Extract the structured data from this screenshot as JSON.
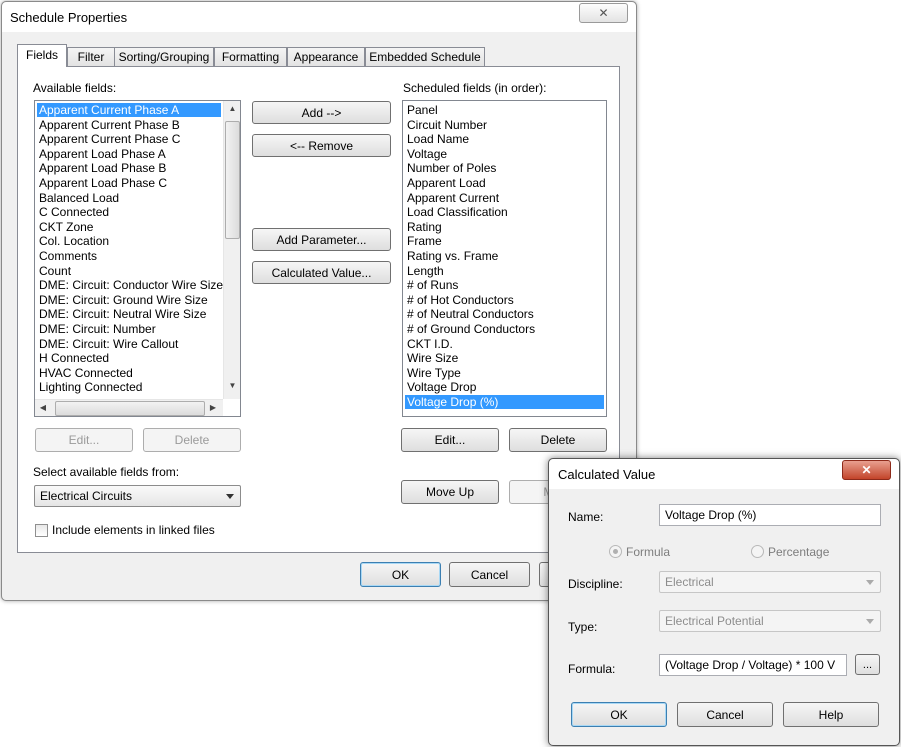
{
  "schedule_properties": {
    "title": "Schedule Properties",
    "tabs": [
      "Fields",
      "Filter",
      "Sorting/Grouping",
      "Formatting",
      "Appearance",
      "Embedded Schedule"
    ],
    "active_tab": "Fields",
    "available_fields_label": "Available fields:",
    "available_fields": [
      "Apparent Current Phase A",
      "Apparent Current Phase B",
      "Apparent Current Phase C",
      "Apparent Load Phase A",
      "Apparent Load Phase B",
      "Apparent Load Phase C",
      "Balanced Load",
      "C Connected",
      "CKT Zone",
      "Col. Location",
      "Comments",
      "Count",
      "DME: Circuit: Conductor Wire Size",
      "DME: Circuit: Ground Wire Size",
      "DME: Circuit: Neutral Wire Size",
      "DME: Circuit: Number",
      "DME: Circuit: Wire Callout",
      "H Connected",
      "HVAC Connected",
      "Lighting Connected"
    ],
    "available_selected_index": 0,
    "scheduled_fields_label": "Scheduled fields (in order):",
    "scheduled_fields": [
      "Panel",
      "Circuit Number",
      "Load Name",
      "Voltage",
      "Number of Poles",
      "Apparent Load",
      "Apparent Current",
      "Load Classification",
      "Rating",
      "Frame",
      "Rating vs. Frame",
      "Length",
      "# of Runs",
      "# of Hot Conductors",
      "# of Neutral Conductors",
      "# of Ground Conductors",
      "CKT I.D.",
      "Wire Size",
      "Wire Type",
      "Voltage Drop",
      "Voltage Drop (%)"
    ],
    "scheduled_selected_index": 20,
    "buttons": {
      "add": "Add -->",
      "remove": "<-- Remove",
      "add_parameter": "Add Parameter...",
      "calculated_value": "Calculated Value...",
      "edit_left": "Edit...",
      "delete_left": "Delete",
      "edit_right": "Edit...",
      "delete_right": "Delete",
      "move_up": "Move Up",
      "move_down": "Move",
      "ok": "OK",
      "cancel": "Cancel"
    },
    "select_from_label": "Select available fields from:",
    "select_from_value": "Electrical Circuits",
    "include_linked_label": "Include elements in linked files",
    "include_linked_checked": false
  },
  "calculated_value": {
    "title": "Calculated Value",
    "close_symbol": "✕",
    "name_label": "Name:",
    "name_value": "Voltage Drop (%)",
    "formula_radio_label": "Formula",
    "percentage_radio_label": "Percentage",
    "formula_radio_selected": true,
    "discipline_label": "Discipline:",
    "discipline_value": "Electrical",
    "type_label": "Type:",
    "type_value": "Electrical Potential",
    "formula_label": "Formula:",
    "formula_value": "(Voltage Drop / Voltage) * 100 V",
    "browse_label": "...",
    "ok": "OK",
    "cancel": "Cancel",
    "help": "Help"
  }
}
